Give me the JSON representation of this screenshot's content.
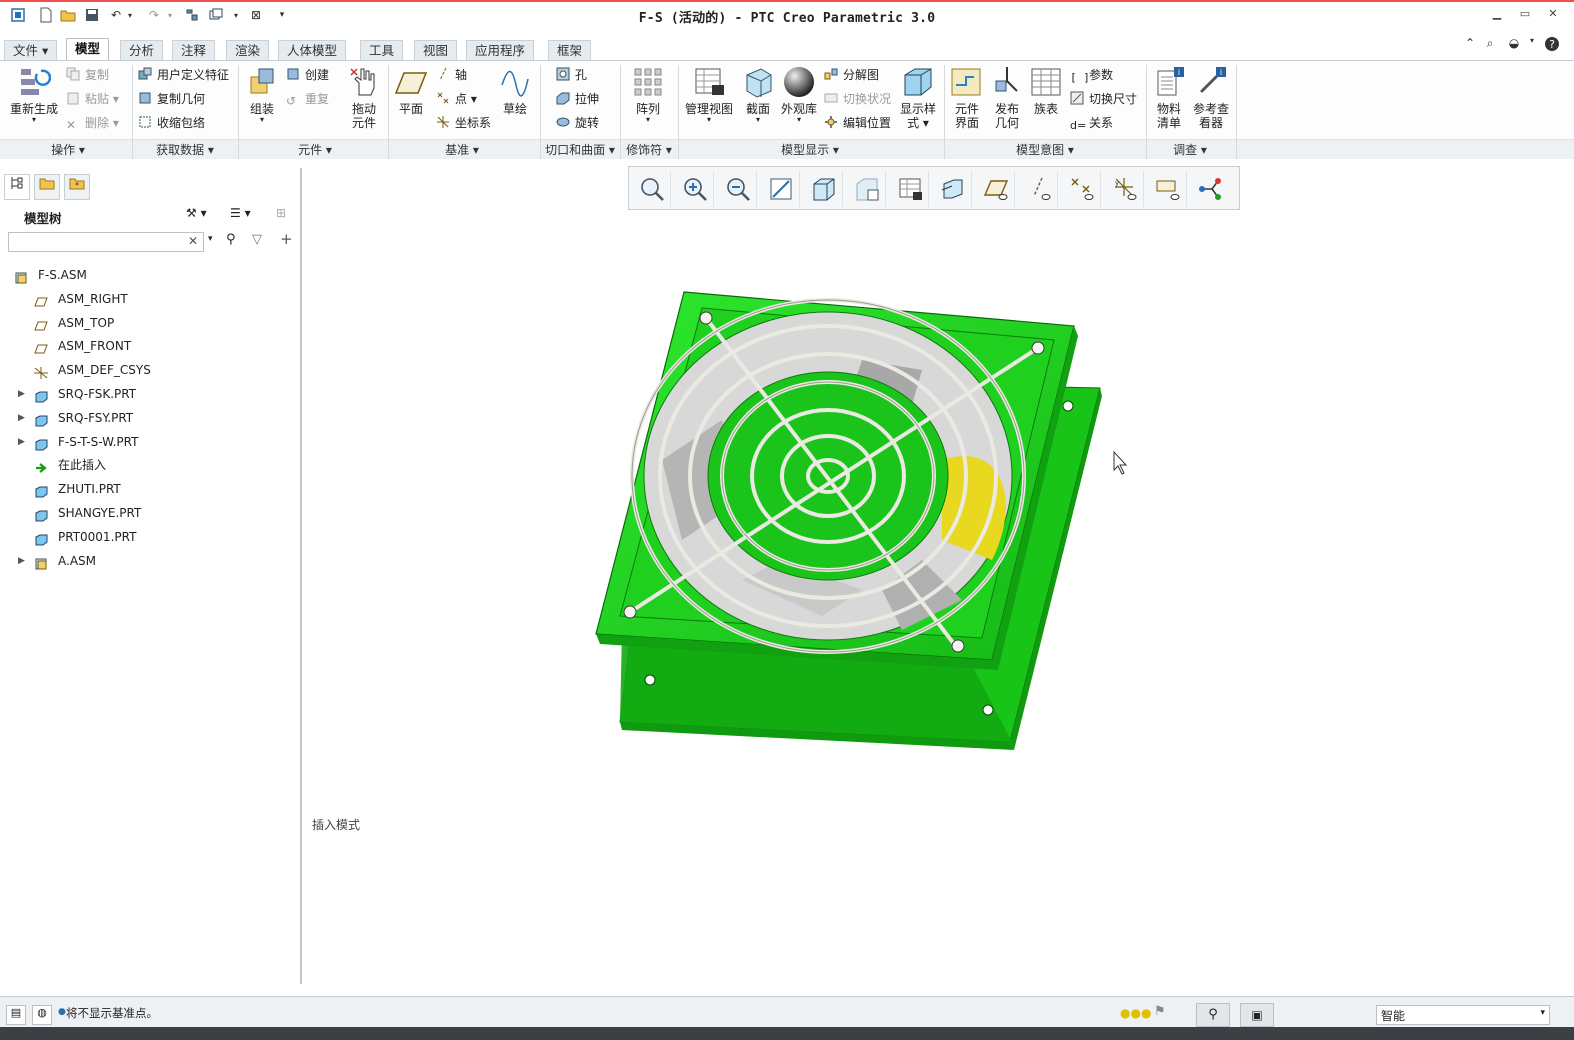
{
  "window": {
    "title": "F-S (活动的) - PTC Creo Parametric 3.0"
  },
  "tabs": [
    {
      "label": "文件",
      "active": false
    },
    {
      "label": "模型",
      "active": true
    },
    {
      "label": "分析",
      "active": false
    },
    {
      "label": "注释",
      "active": false
    },
    {
      "label": "渲染",
      "active": false
    },
    {
      "label": "人体模型",
      "active": false
    },
    {
      "label": "工具",
      "active": false
    },
    {
      "label": "视图",
      "active": false
    },
    {
      "label": "应用程序",
      "active": false
    },
    {
      "label": "框架",
      "active": false
    }
  ],
  "ribbon": {
    "operations": {
      "group": "操作",
      "regenerate": "重新生成",
      "copy": "复制",
      "paste": "粘贴",
      "delete": "删除"
    },
    "get_data": {
      "group": "获取数据",
      "udf": "用户定义特征",
      "copy_geom": "复制几何",
      "shrinkwrap": "收缩包络"
    },
    "component": {
      "group": "元件",
      "assemble": "组装",
      "create": "创建",
      "repeat": "重复",
      "drag_line1": "拖动",
      "drag_line2": "元件"
    },
    "datum": {
      "group": "基准",
      "plane": "平面",
      "axis": "轴",
      "point": "点",
      "csys": "坐标系",
      "sketch": "草绘"
    },
    "cut_surface": {
      "group": "切口和曲面",
      "hole": "孔",
      "extrude": "拉伸",
      "revolve": "旋转"
    },
    "modifiers": {
      "group": "修饰符",
      "pattern": "阵列"
    },
    "model_display": {
      "group": "模型显示",
      "manage_view": "管理视图",
      "section": "截面",
      "appearance": "外观库",
      "explode": "分解图",
      "toggle_status": "切换状况",
      "edit_position": "编辑位置",
      "display_style_line1": "显示样",
      "display_style_line2": "式"
    },
    "model_intent": {
      "group": "模型意图",
      "comp_iface_line1": "元件",
      "comp_iface_line2": "界面",
      "publish_line1": "发布",
      "publish_line2": "几何",
      "family_table": "族表",
      "parameters": "参数",
      "switch_dims": "切换尺寸",
      "relations": "关系"
    },
    "investigate": {
      "group": "调查",
      "bom_line1": "物料",
      "bom_line2": "清单",
      "ref_viewer_line1": "参考查",
      "ref_viewer_line2": "看器"
    }
  },
  "model_tree": {
    "title": "模型树",
    "search_value": "",
    "items": [
      {
        "label": "F-S.ASM",
        "type": "assembly",
        "expandable": false,
        "indent": 0
      },
      {
        "label": "ASM_RIGHT",
        "type": "plane",
        "expandable": false,
        "indent": 1
      },
      {
        "label": "ASM_TOP",
        "type": "plane",
        "expandable": false,
        "indent": 1
      },
      {
        "label": "ASM_FRONT",
        "type": "plane",
        "expandable": false,
        "indent": 1
      },
      {
        "label": "ASM_DEF_CSYS",
        "type": "csys",
        "expandable": false,
        "indent": 1
      },
      {
        "label": "SRQ-FSK.PRT",
        "type": "part",
        "expandable": true,
        "indent": 1
      },
      {
        "label": "SRQ-FSY.PRT",
        "type": "part",
        "expandable": true,
        "indent": 1
      },
      {
        "label": "F-S-T-S-W.PRT",
        "type": "part",
        "expandable": true,
        "indent": 1
      },
      {
        "label": "在此插入",
        "type": "insert",
        "expandable": false,
        "indent": 1
      },
      {
        "label": "ZHUTI.PRT",
        "type": "part",
        "expandable": false,
        "indent": 1
      },
      {
        "label": "SHANGYE.PRT",
        "type": "part",
        "expandable": false,
        "indent": 1
      },
      {
        "label": "PRT0001.PRT",
        "type": "part",
        "expandable": false,
        "indent": 1
      },
      {
        "label": "A.ASM",
        "type": "assembly",
        "expandable": true,
        "indent": 1
      }
    ]
  },
  "graphics": {
    "mode_text": "插入模式"
  },
  "status": {
    "message": "将不显示基准点。",
    "filter_value": "智能"
  },
  "colors": {
    "model_green": "#22dd22",
    "model_dark_green": "#10a010",
    "grille": "#e8e8e0",
    "blade": "#bdbdbd",
    "highlight_yellow": "#e8d820",
    "accent_red": "#f05050"
  }
}
